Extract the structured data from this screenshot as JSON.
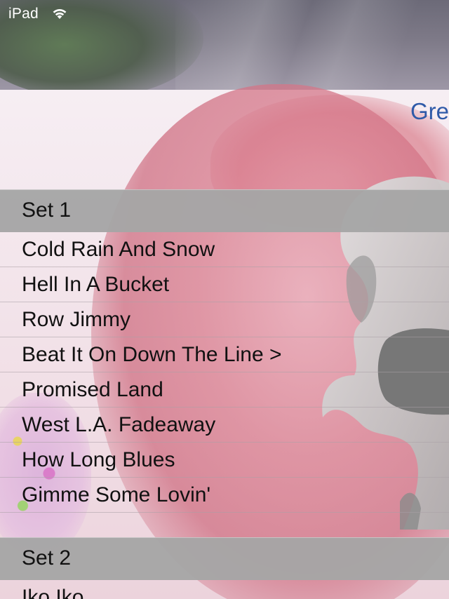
{
  "status_bar": {
    "carrier": "iPad",
    "wifi_icon": "wifi-icon"
  },
  "nav": {
    "title": "Gre"
  },
  "sections": [
    {
      "header": "Set 1",
      "songs": [
        "Cold Rain And Snow",
        "Hell In A Bucket",
        "Row Jimmy",
        "Beat It On Down The Line >",
        "Promised Land",
        "West L.A. Fadeaway",
        "How Long Blues",
        "Gimme Some Lovin'"
      ]
    },
    {
      "header": "Set 2",
      "songs": [
        "Iko Iko"
      ]
    }
  ],
  "colors": {
    "nav_title": "#2f5aa8",
    "section_header_bg": "#a5a5a5",
    "text": "#111111"
  }
}
